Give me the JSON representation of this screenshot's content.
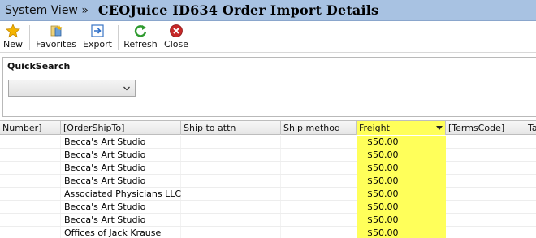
{
  "window": {
    "system_view": "System View »",
    "title": "CEOJuice ID634 Order Import Details"
  },
  "toolbar": {
    "new": "New",
    "favorites": "Favorites",
    "export": "Export",
    "refresh": "Refresh",
    "close": "Close"
  },
  "quicksearch": {
    "label": "QuickSearch",
    "selected": ""
  },
  "grid": {
    "columns": [
      "Number]",
      "[OrderShipTo]",
      "Ship to attn",
      "Ship method",
      "Freight",
      "[TermsCode]",
      "Ta"
    ],
    "sorted_column": "Freight",
    "rows": [
      {
        "ship_to": "Becca's Art Studio",
        "freight": "$50.00"
      },
      {
        "ship_to": "Becca's Art Studio",
        "freight": "$50.00"
      },
      {
        "ship_to": "Becca's Art Studio",
        "freight": "$50.00"
      },
      {
        "ship_to": "Becca's Art Studio",
        "freight": "$50.00"
      },
      {
        "ship_to": "Associated Physicians LLC",
        "freight": "$50.00"
      },
      {
        "ship_to": "Becca's Art Studio",
        "freight": "$50.00"
      },
      {
        "ship_to": "Becca's Art Studio",
        "freight": "$50.00"
      },
      {
        "ship_to": "Offices of Jack Krause",
        "freight": "$50.00"
      }
    ]
  },
  "colors": {
    "titlebar": "#a8c2e2",
    "highlight": "#ffff5a"
  }
}
